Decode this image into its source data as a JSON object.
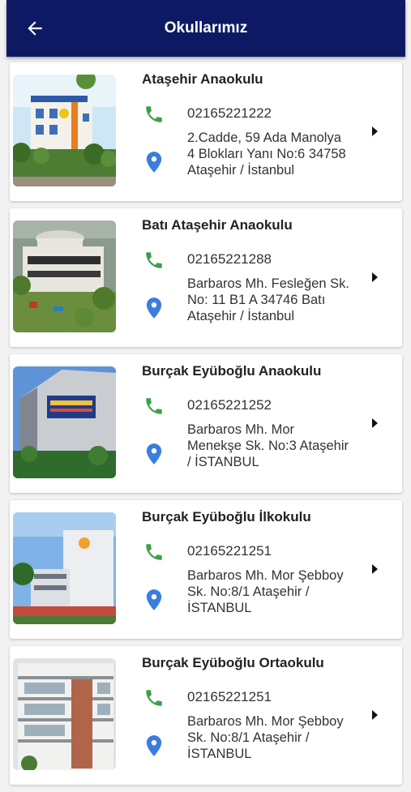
{
  "header": {
    "title": "Okullarımız"
  },
  "schools": [
    {
      "name": "Ataşehir Anaokulu",
      "phone": "02165221222",
      "address": "2.Cadde, 59 Ada Manolya 4 Blokları Yanı No:6 34758 Ataşehir / İstanbul"
    },
    {
      "name": "Batı Ataşehir Anaokulu",
      "phone": "02165221288",
      "address": "Barbaros Mh. Fesleğen Sk. No: 11 B1 A 34746 Batı Ataşehir / İstanbul"
    },
    {
      "name": "Burçak Eyüboğlu Anaokulu",
      "phone": "02165221252",
      "address": "Barbaros Mh. Mor Menekşe Sk. No:3 Ataşehir / İSTANBUL"
    },
    {
      "name": "Burçak Eyüboğlu İlkokulu",
      "phone": "02165221251",
      "address": "Barbaros Mh. Mor Şebboy Sk. No:8/1 Ataşehir / İSTANBUL"
    },
    {
      "name": "Burçak Eyüboğlu Ortaokulu",
      "phone": "02165221251",
      "address": "Barbaros Mh. Mor Şebboy Sk. No:8/1 Ataşehir / İSTANBUL"
    }
  ],
  "colors": {
    "appbar": "#0d1a63",
    "phone_icon": "#3aa04a",
    "pin_icon": "#3b7ddd"
  },
  "icons": {
    "back": "arrow-left-icon",
    "phone": "phone-icon",
    "location": "location-pin-icon",
    "chevron": "chevron-right-icon"
  }
}
